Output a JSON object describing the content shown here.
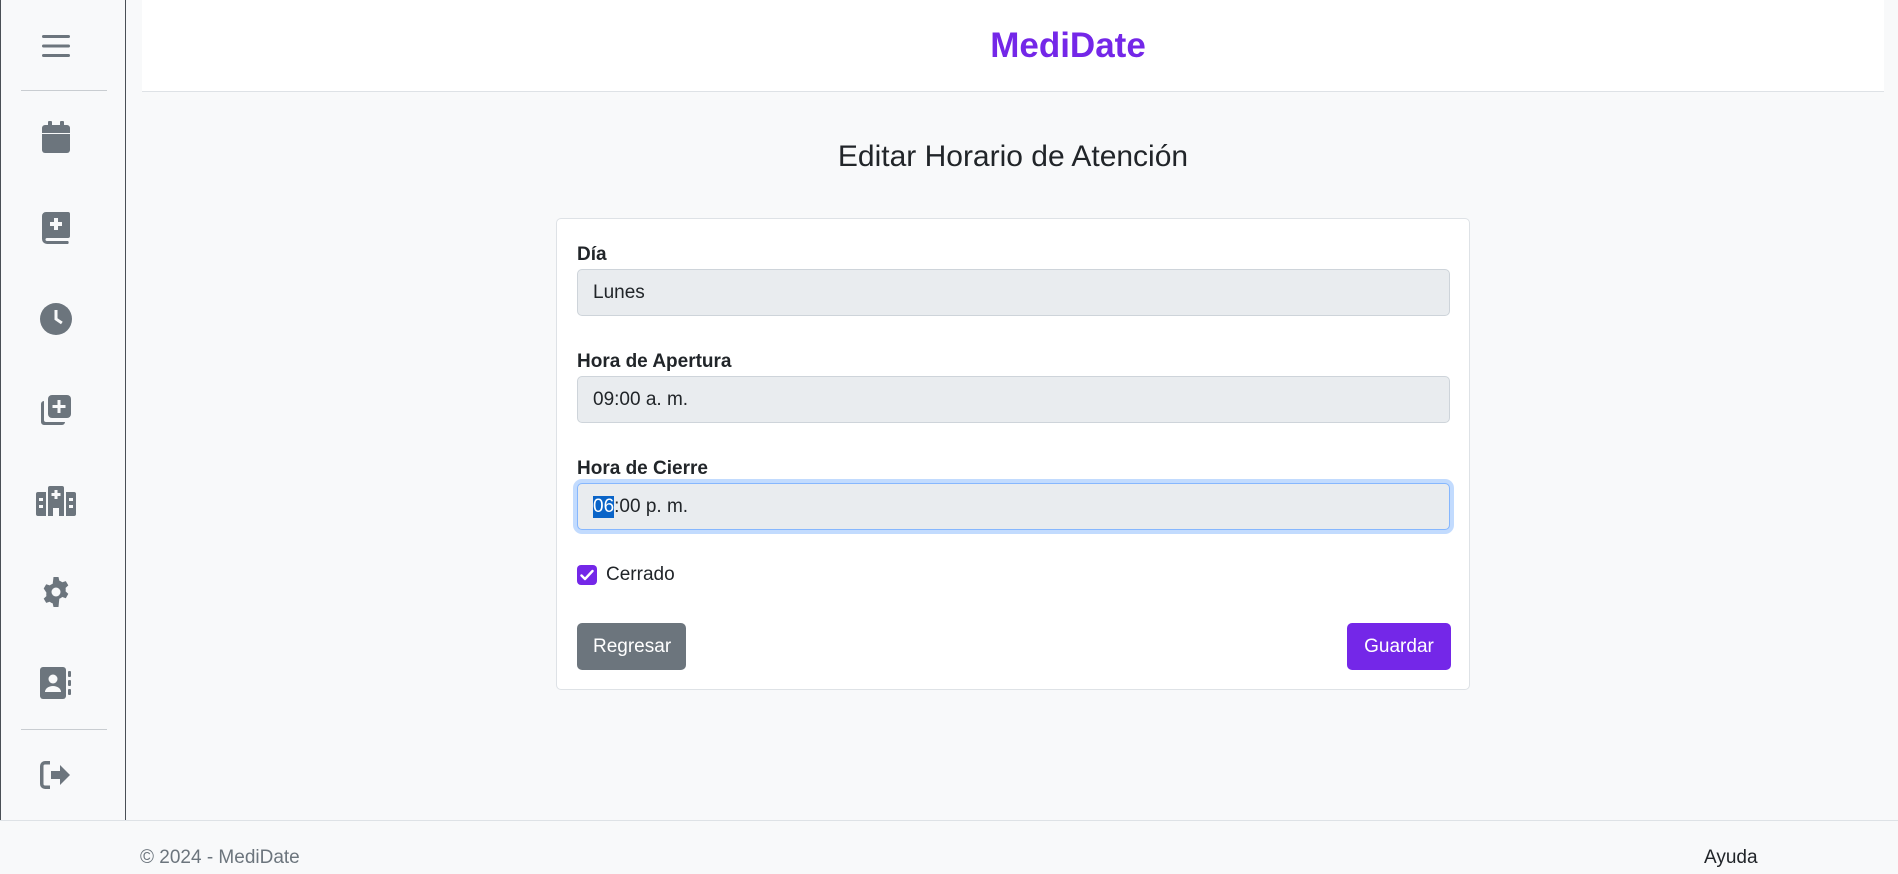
{
  "app": {
    "brand": "MediDate"
  },
  "sidebar": {
    "items": [
      {
        "icon": "menu-icon"
      },
      {
        "icon": "calendar-icon"
      },
      {
        "icon": "medical-book-icon"
      },
      {
        "icon": "clock-icon"
      },
      {
        "icon": "add-copy-icon"
      },
      {
        "icon": "hospital-icon"
      },
      {
        "icon": "gear-icon"
      },
      {
        "icon": "contact-book-icon"
      },
      {
        "icon": "logout-icon"
      }
    ]
  },
  "page": {
    "title": "Editar Horario de Atención"
  },
  "form": {
    "day": {
      "label": "Día",
      "value": "Lunes"
    },
    "open": {
      "label": "Hora de Apertura",
      "hour": "09",
      "minute": "00",
      "period": "a. m."
    },
    "close": {
      "label": "Hora de Cierre",
      "hour": "06",
      "minute": "00",
      "period": "p. m."
    },
    "closed": {
      "label": "Cerrado",
      "checked": true
    },
    "back_label": "Regresar",
    "save_label": "Guardar"
  },
  "footer": {
    "copyright": "© 2024 - MediDate",
    "help": "Ayuda"
  },
  "colors": {
    "accent": "#7427e8",
    "secondary": "#6c757d"
  }
}
